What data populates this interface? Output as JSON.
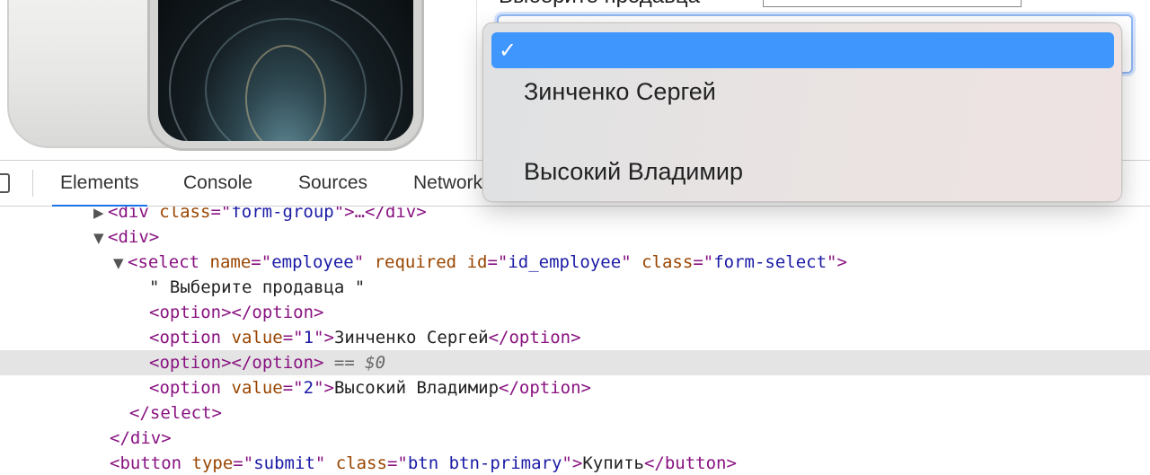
{
  "page": {
    "seller_label": "Выберите продавца"
  },
  "dropdown": {
    "options": [
      {
        "label": "",
        "selected": true
      },
      {
        "label": "Зинченко Сергей",
        "selected": false
      },
      {
        "label": "Высокий Владимир",
        "selected": false
      }
    ]
  },
  "devtools": {
    "tabs": [
      "Elements",
      "Console",
      "Sources",
      "Network"
    ],
    "active_tab": "Elements"
  },
  "tree": {
    "l0": {
      "open": "<",
      "tag": "div",
      "attr": "class",
      "eq": "=\"",
      "val": "form-group",
      "close": "\">…</div>"
    },
    "l1": {
      "text": "<div>"
    },
    "l2": {
      "open": "<select",
      "a1": "name",
      "v1": "employee",
      "a2": "required",
      "a3": "id",
      "v3": "id_employee",
      "a4": "class",
      "v4": "form-select",
      "close": ">"
    },
    "l3": {
      "text": "\" Выберите продавца \""
    },
    "l4": {
      "text": "<option></option>"
    },
    "l5": {
      "open": "<option",
      "attr": "value",
      "val": "1",
      "gt": ">",
      "text": "Зинченко Сергей",
      "close": "</option>"
    },
    "l6": {
      "text": "<option></option>",
      "marker": "== $0"
    },
    "l7": {
      "open": "<option",
      "attr": "value",
      "val": "2",
      "gt": ">",
      "text": "Высокий Владимир",
      "close": "</option>"
    },
    "l8": {
      "text": "</select>"
    },
    "l9": {
      "text": "</div>"
    },
    "l10": {
      "open": "<button",
      "a1": "type",
      "v1": "submit",
      "a2": "class",
      "v2": "btn btn-primary",
      "gt": ">",
      "text": "Купить",
      "close": "</button>"
    }
  },
  "colors": {
    "selected_option": "#3f96fd",
    "active_tab_underline": "#1a73e8",
    "tag": "#881280",
    "attr_name": "#994500",
    "attr_value": "#1a1aa6"
  }
}
